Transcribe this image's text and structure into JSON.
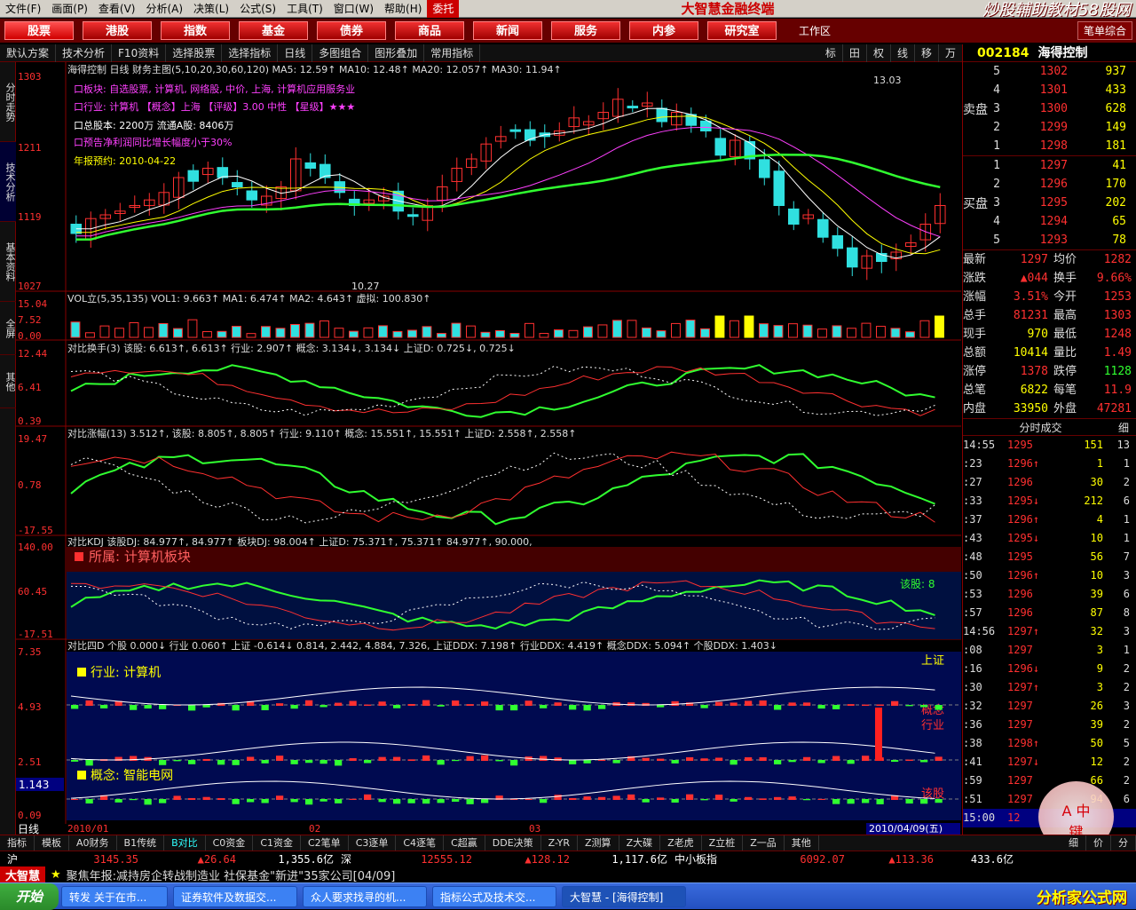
{
  "menu": {
    "items": [
      "文件(F)",
      "画面(P)",
      "查看(V)",
      "分析(A)",
      "决策(L)",
      "公式(S)",
      "工具(T)",
      "窗口(W)",
      "帮助(H)",
      "委托"
    ],
    "window_title": "大智慧金融终端",
    "watermark": "炒股辅助教材58股网",
    "watermark_url": "www.58Gu.com"
  },
  "nav": {
    "buttons": [
      "股票",
      "港股",
      "指数",
      "基金",
      "债券",
      "商品",
      "新闻",
      "服务",
      "内参",
      "研究室"
    ],
    "work_area": "工作区",
    "right_btn": "笔单综合"
  },
  "toolbar": {
    "items": [
      "默认方案",
      "技术分析",
      "F10资料",
      "选择股票",
      "选择指标",
      "日线",
      "多图组合",
      "图形叠加",
      "常用指标"
    ],
    "right_items": [
      "标",
      "田",
      "权",
      "线",
      "移",
      "万"
    ]
  },
  "left_tabs": [
    "分时走势",
    "技术分析",
    "基本资料",
    "全屏",
    "其他"
  ],
  "stock": {
    "code": "002184",
    "name": "海得控制",
    "period": "日线"
  },
  "main_panel": {
    "header": "海得控制 日线 财务主图(5,10,20,30,60,120) MA5: 12.59↑ MA10: 12.48↑ MA20: 12.057↑ MA30: 11.94↑",
    "info_lines": [
      "口板块: 自选股票, 计算机, 网络股, 中价, 上海, 计算机应用服务业",
      "口行业: 计算机  【概念】上海  【评级】3.00 中性  【星级】★★★",
      "口总股本: 2200万 流通A股: 8406万",
      "口预告净利润同比增长幅度小于30%",
      "年报预约: 2010-04-22"
    ],
    "y_labels": [
      "1303",
      "1211",
      "1119",
      "1027"
    ],
    "high_label": "13.03",
    "low_label": "10.27"
  },
  "vol_panel": {
    "header": "VOL立(5,35,135) VOL1: 9.663↑ MA1: 6.474↑ MA2: 4.643↑ 虚拟: 100.830↑",
    "y_labels": [
      "15.04",
      "7.52",
      "0.00"
    ]
  },
  "turnover_panel": {
    "header": "对比换手(3) 该股: 6.613↑, 6.613↑ 行业: 2.907↑ 概念: 3.134↓, 3.134↓ 上证D: 0.725↓, 0.725↓",
    "y_labels": [
      "12.44",
      "6.41",
      "0.39"
    ]
  },
  "change_panel": {
    "header": "对比涨幅(13) 3.512↑, 该股: 8.805↑, 8.805↑ 行业: 9.110↑ 概念: 15.551↑, 15.551↑ 上证D: 2.558↑, 2.558↑",
    "y_labels": [
      "19.47",
      "0.78",
      "-17.55"
    ]
  },
  "kdj_panel": {
    "header": "对比KDJ 该股DJ: 84.977↑, 84.977↑ 板块DJ: 98.004↑ 上证D: 75.371↑, 75.371↑ 84.977↑, 90.000,",
    "y_labels": [
      "140.00",
      "60.45",
      "-17.51"
    ],
    "banner": "所属: 计算机板块",
    "series_label": "该股: 8"
  },
  "ddx_panel": {
    "header": "对比四D 个股 0.000↓ 行业 0.060↑ 上证 -0.614↓ 0.814, 2.442, 4.884, 7.326, 上证DDX: 7.198↑ 行业DDX: 4.419↑ 概念DDX: 5.094↑ 个股DDX: 1.403↓",
    "y_labels": [
      "7.35",
      "4.93",
      "2.51",
      "0.09"
    ],
    "industry_banner": "行业: 计算机",
    "concept_banner": "概念: 智能电网",
    "right_labels": [
      "上证",
      "概念",
      "行业",
      "该股"
    ],
    "cursor_value": "1.143"
  },
  "date_axis": {
    "labels": [
      "2010/01",
      "02",
      "03",
      "2010/04/09(五)"
    ],
    "period": "日线"
  },
  "order_book": {
    "code": "002184",
    "name": "海得控制",
    "sell_side": "卖盘",
    "buy_side": "买盘",
    "sells": [
      {
        "lv": "5",
        "price": "1302",
        "vol": "937"
      },
      {
        "lv": "4",
        "price": "1301",
        "vol": "433"
      },
      {
        "lv": "3",
        "price": "1300",
        "vol": "628"
      },
      {
        "lv": "2",
        "price": "1299",
        "vol": "149"
      },
      {
        "lv": "1",
        "price": "1298",
        "vol": "181"
      }
    ],
    "buys": [
      {
        "lv": "1",
        "price": "1297",
        "vol": "41"
      },
      {
        "lv": "2",
        "price": "1296",
        "vol": "170"
      },
      {
        "lv": "3",
        "price": "1295",
        "vol": "202"
      },
      {
        "lv": "4",
        "price": "1294",
        "vol": "65"
      },
      {
        "lv": "5",
        "price": "1293",
        "vol": "78"
      }
    ]
  },
  "quote": [
    {
      "k": "最新",
      "v": "1297",
      "k2": "均价",
      "v2": "1282"
    },
    {
      "k": "涨跌",
      "v": "▲044",
      "k2": "换手",
      "v2": "9.66%"
    },
    {
      "k": "涨幅",
      "v": "3.51%",
      "k2": "今开",
      "v2": "1253"
    },
    {
      "k": "总手",
      "v": "81231",
      "k2": "最高",
      "v2": "1303"
    },
    {
      "k": "现手",
      "v": "970",
      "k2": "最低",
      "v2": "1248"
    },
    {
      "k": "总额",
      "v": "10414",
      "k2": "量比",
      "v2": "1.49"
    },
    {
      "k": "涨停",
      "v": "1378",
      "k2": "跌停",
      "v2": "1128"
    },
    {
      "k": "总笔",
      "v": "6822",
      "k2": "每笔",
      "v2": "11.9"
    },
    {
      "k": "内盘",
      "v": "33950",
      "k2": "外盘",
      "v2": "47281"
    }
  ],
  "trades_title": "分时成交",
  "trades_tab": "细",
  "trades": [
    {
      "t": "14:55",
      "p": "1295",
      "v": "151",
      "n": "13"
    },
    {
      "t": ":23",
      "p": "1296↑",
      "v": "1",
      "n": "1"
    },
    {
      "t": ":27",
      "p": "1296",
      "v": "30",
      "n": "2"
    },
    {
      "t": ":33",
      "p": "1295↓",
      "v": "212",
      "n": "6"
    },
    {
      "t": ":37",
      "p": "1296↑",
      "v": "4",
      "n": "1"
    },
    {
      "t": ":43",
      "p": "1295↓",
      "v": "10",
      "n": "1"
    },
    {
      "t": ":48",
      "p": "1295",
      "v": "56",
      "n": "7"
    },
    {
      "t": ":50",
      "p": "1296↑",
      "v": "10",
      "n": "3"
    },
    {
      "t": ":53",
      "p": "1296",
      "v": "39",
      "n": "6"
    },
    {
      "t": ":57",
      "p": "1296",
      "v": "87",
      "n": "8"
    },
    {
      "t": "14:56",
      "p": "1297↑",
      "v": "32",
      "n": "3"
    },
    {
      "t": ":08",
      "p": "1297",
      "v": "3",
      "n": "1"
    },
    {
      "t": ":16",
      "p": "1296↓",
      "v": "9",
      "n": "2"
    },
    {
      "t": ":30",
      "p": "1297↑",
      "v": "3",
      "n": "2"
    },
    {
      "t": ":32",
      "p": "1297",
      "v": "26",
      "n": "3"
    },
    {
      "t": ":36",
      "p": "1297",
      "v": "39",
      "n": "2"
    },
    {
      "t": ":38",
      "p": "1298↑",
      "v": "50",
      "n": "5"
    },
    {
      "t": ":41",
      "p": "1297↓",
      "v": "12",
      "n": "2"
    },
    {
      "t": ":59",
      "p": "1297",
      "v": "66",
      "n": "2"
    },
    {
      "t": ":51",
      "p": "1297",
      "v": "94",
      "n": "6"
    },
    {
      "t": "15:00",
      "p": "12",
      "v": "",
      "n": ""
    }
  ],
  "bottom_tabs": [
    "指标",
    "模板",
    "A0财务",
    "B1传统",
    "B对比",
    "C0资金",
    "C1资金",
    "C2笔单",
    "C3逐单",
    "C4逐笔",
    "C超赢",
    "DDE决策",
    "Z-YR",
    "Z测算",
    "Z大碟",
    "Z老虎",
    "Z立桩",
    "Z一品",
    "其他"
  ],
  "right_bottom_tabs": [
    "细",
    "价",
    "分"
  ],
  "index_bar": {
    "sh_label": "沪",
    "sh_value": "3145.35",
    "sh_change": "▲26.64",
    "sh_amount": "1,355.6亿",
    "sz_label": "深",
    "sz_value": "12555.12",
    "sz_change": "▲128.12",
    "sz_amount": "1,117.6亿",
    "sme_label": "中小板指",
    "sme_value": "6092.07",
    "sme_change": "▲113.36",
    "sme_amount": "433.6亿"
  },
  "ticker": {
    "brand": "大智慧",
    "text": "聚焦年报:减持房企转战制造业 社保基金\"新进\"35家公司[04/09]"
  },
  "taskbar": {
    "start": "开始",
    "items": [
      "转发 关于在市...",
      "证券软件及数据交...",
      "众人要求找寻的机...",
      "指标公式及技术交...",
      "大智慧 - [海得控制]"
    ],
    "logo_text": "分析家公式网",
    "logo_url": "www.88gs.com"
  },
  "stamp": {
    "text1": "A",
    "text2": "中",
    "text3": "键"
  },
  "colors": {
    "up": "#ff3030",
    "down": "#30e0e0",
    "accent": "#ffff00",
    "nav_bg": "#660000"
  }
}
